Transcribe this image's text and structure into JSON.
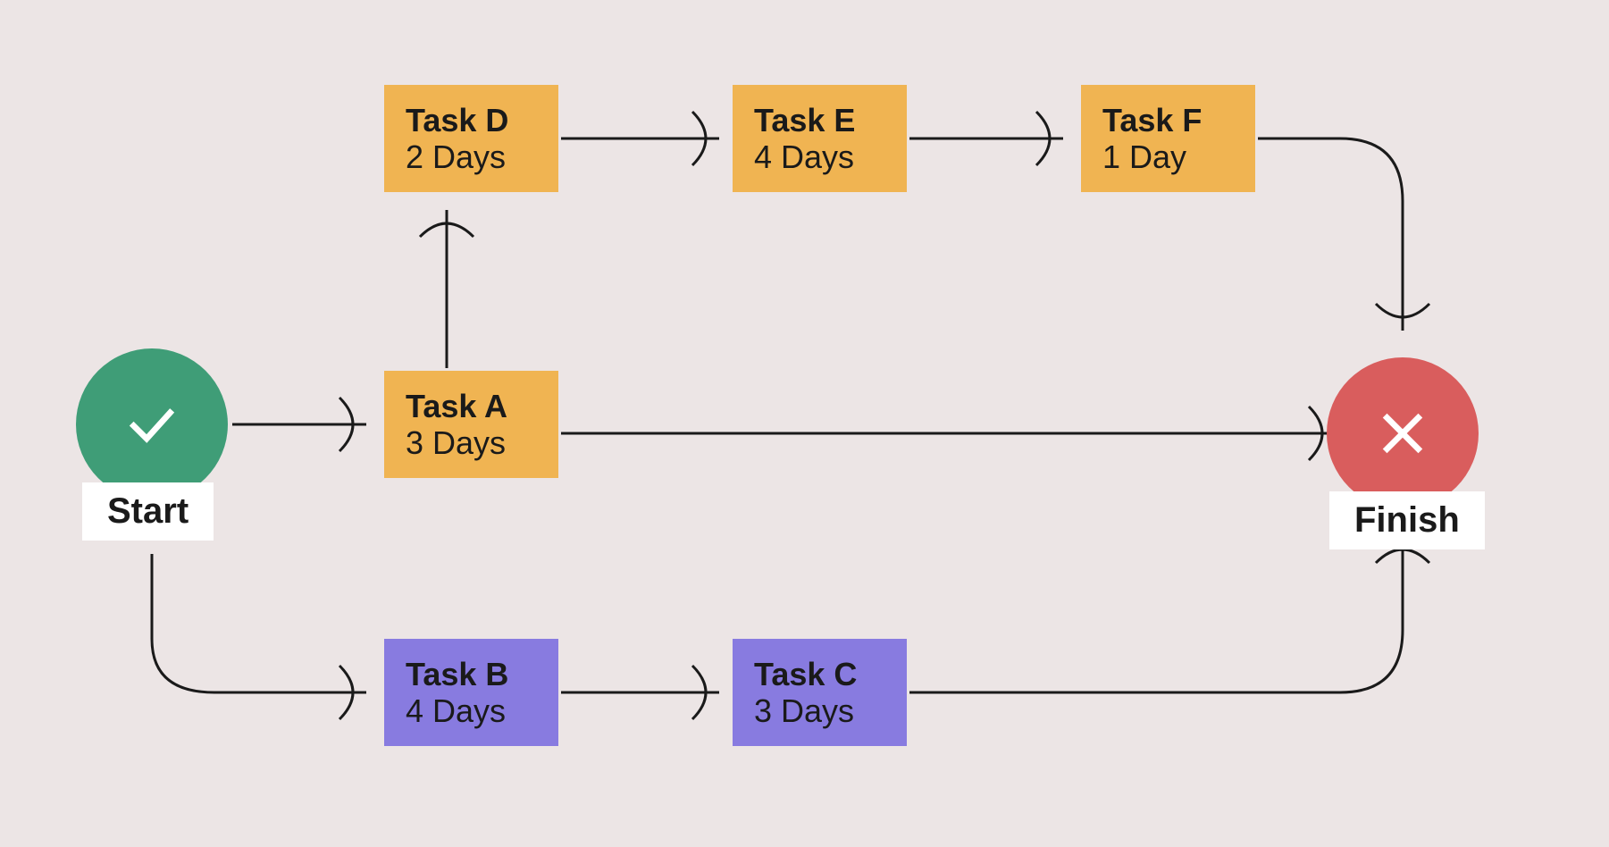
{
  "start": {
    "label": "Start"
  },
  "finish": {
    "label": "Finish"
  },
  "tasks": {
    "A": {
      "title": "Task A",
      "days": "3 Days",
      "color": "orange"
    },
    "B": {
      "title": "Task B",
      "days": "4 Days",
      "color": "purple"
    },
    "C": {
      "title": "Task C",
      "days": "3 Days",
      "color": "purple"
    },
    "D": {
      "title": "Task D",
      "days": "2 Days",
      "color": "orange"
    },
    "E": {
      "title": "Task E",
      "days": "4 Days",
      "color": "orange"
    },
    "F": {
      "title": "Task F",
      "days": "1 Day",
      "color": "orange"
    }
  },
  "edges": [
    {
      "from": "Start",
      "to": "Task A"
    },
    {
      "from": "Start",
      "to": "Task B"
    },
    {
      "from": "Task A",
      "to": "Task D"
    },
    {
      "from": "Task A",
      "to": "Finish"
    },
    {
      "from": "Task B",
      "to": "Task C"
    },
    {
      "from": "Task C",
      "to": "Finish"
    },
    {
      "from": "Task D",
      "to": "Task E"
    },
    {
      "from": "Task E",
      "to": "Task F"
    },
    {
      "from": "Task F",
      "to": "Finish"
    }
  ],
  "colors": {
    "start": "#3f9d77",
    "finish": "#d95d5d",
    "orange": "#f0b452",
    "purple": "#887be0",
    "bg": "#ece5e5"
  }
}
